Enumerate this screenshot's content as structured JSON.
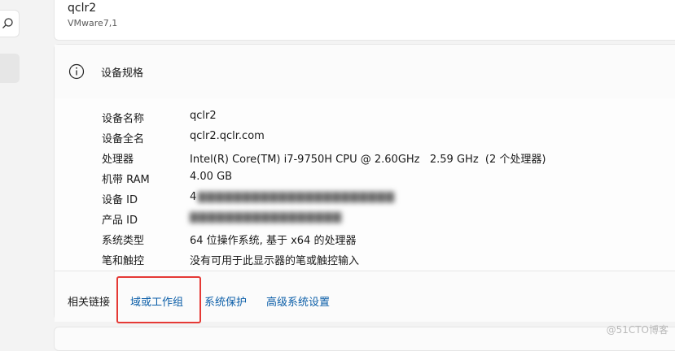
{
  "sidebar": {
    "search_icon": "search-icon"
  },
  "device": {
    "name": "qclr2",
    "model": "VMware7,1"
  },
  "specs": {
    "title": "设备规格",
    "info_icon": "info-icon",
    "rows": [
      {
        "label": "设备名称",
        "value": "qclr2"
      },
      {
        "label": "设备全名",
        "value": "qclr2.qclr.com"
      },
      {
        "label": "处理器",
        "value": "Intel(R) Core(TM) i7-9750H CPU @ 2.60GHz   2.59 GHz  (2 个处理器)"
      },
      {
        "label": "机带 RAM",
        "value": "4.00 GB"
      },
      {
        "label": "设备 ID",
        "value": "4"
      },
      {
        "label": "产品 ID",
        "value": ""
      },
      {
        "label": "系统类型",
        "value": "64 位操作系统, 基于 x64 的处理器"
      },
      {
        "label": "笔和触控",
        "value": "没有可用于此显示器的笔或触控输入"
      }
    ]
  },
  "related_links": {
    "label": "相关链接",
    "links": [
      "域或工作组",
      "系统保护",
      "高级系统设置"
    ]
  },
  "watermark": "@51CTO博客",
  "colors": {
    "link": "#0b5ea8",
    "highlight": "#e53935"
  }
}
